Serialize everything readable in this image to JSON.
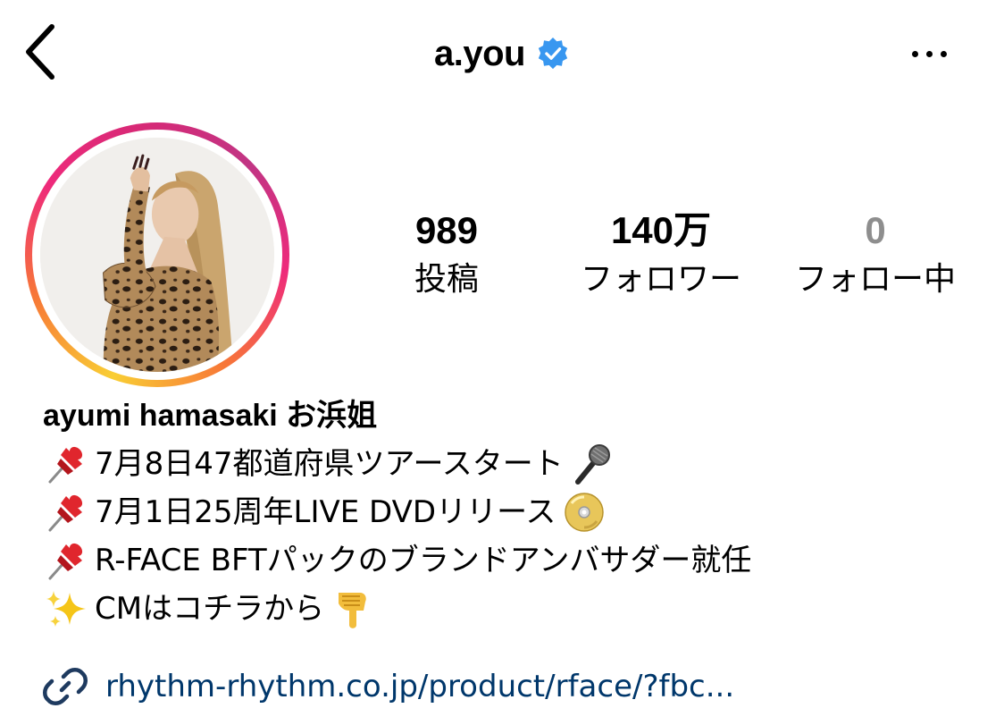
{
  "header": {
    "back_icon": "chevron-left-icon",
    "username": "a.you",
    "verified_icon": "verified-badge-icon",
    "more_icon": "more-horizontal-icon"
  },
  "profile": {
    "avatar_icon": "profile-photo",
    "story_ring_colors": [
      "#f9ce34",
      "#ee2a7b",
      "#c13584"
    ]
  },
  "stats": {
    "posts": {
      "value": "989",
      "label": "投稿"
    },
    "followers": {
      "value": "140万",
      "label": "フォロワー"
    },
    "following": {
      "value": "0",
      "label": "フォロー中"
    }
  },
  "bio": {
    "name": "ayumi hamasaki お浜姐",
    "lines": [
      {
        "lead_icon": "pushpin-emoji",
        "text": "7月8日47都道府県ツアースタート",
        "trail_icon": "microphone-emoji"
      },
      {
        "lead_icon": "pushpin-emoji",
        "text": "7月1日25周年LIVE DVDリリース",
        "trail_icon": "dvd-emoji"
      },
      {
        "lead_icon": "pushpin-emoji",
        "text": "R-FACE BFTパックのブランドアンバサダー就任"
      },
      {
        "lead_icon": "sparkles-emoji",
        "text": "CMはコチラから",
        "trail_icon": "pointing-down-emoji"
      }
    ]
  },
  "link": {
    "icon": "link-icon",
    "text": "rhythm-rhythm.co.jp/product/rface/?fbc...",
    "color": "#00376b"
  }
}
